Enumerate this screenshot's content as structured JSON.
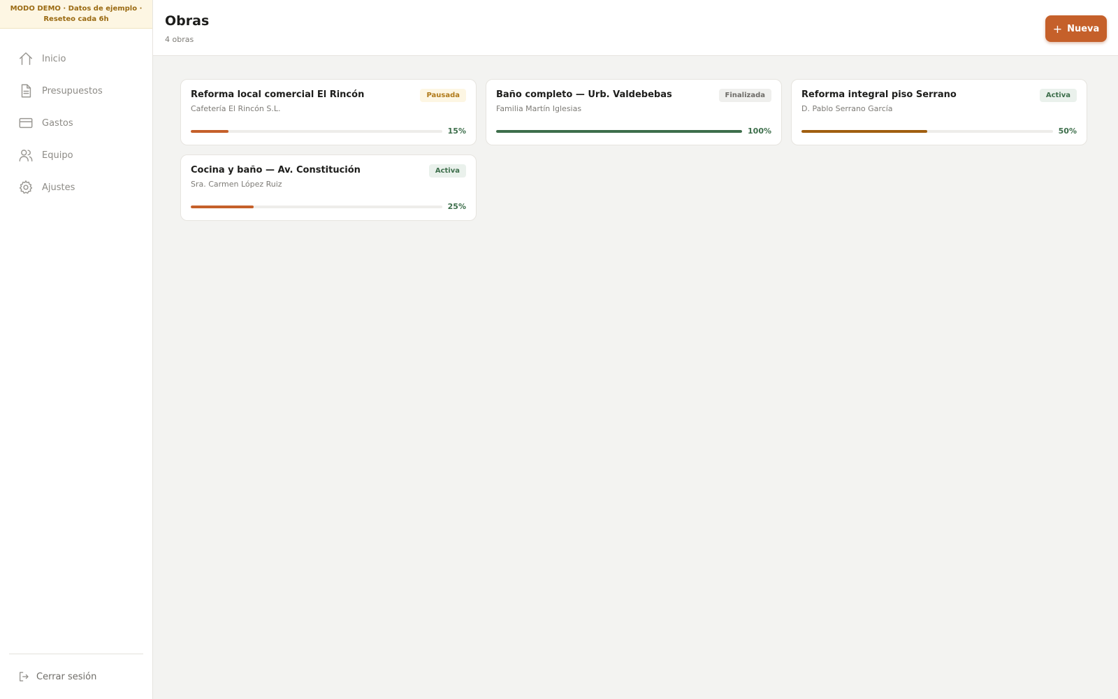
{
  "banner": {
    "line1": "MODO DEMO · Datos de ejemplo ·",
    "line2": "Reseteo cada 6h"
  },
  "sidebar": {
    "items": [
      {
        "label": "Inicio",
        "icon": "home-icon"
      },
      {
        "label": "Presupuestos",
        "icon": "document-icon"
      },
      {
        "label": "Gastos",
        "icon": "credit-card-icon"
      },
      {
        "label": "Equipo",
        "icon": "users-icon"
      },
      {
        "label": "Ajustes",
        "icon": "gear-icon"
      }
    ],
    "logout_label": "Cerrar sesión"
  },
  "header": {
    "title": "Obras",
    "subtitle": "4 obras",
    "new_button_label": "Nueva"
  },
  "colors": {
    "accent": "#c5602a",
    "progress_orange": "#c5602a",
    "progress_green": "#3d6e4b",
    "progress_amber": "#a05f10"
  },
  "projects": [
    {
      "title": "Reforma local comercial El Rincón",
      "client": "Cafetería El Rincón S.L.",
      "status": "Pausada",
      "progress": 15,
      "progress_label": "15%",
      "bar_color": "#c5602a"
    },
    {
      "title": "Baño completo — Urb. Valdebebas",
      "client": "Familia Martín Iglesias",
      "status": "Finalizada",
      "progress": 100,
      "progress_label": "100%",
      "bar_color": "#3d6e4b"
    },
    {
      "title": "Reforma integral piso Serrano",
      "client": "D. Pablo Serrano García",
      "status": "Activa",
      "progress": 50,
      "progress_label": "50%",
      "bar_color": "#a05f10"
    },
    {
      "title": "Cocina y baño — Av. Constitución",
      "client": "Sra. Carmen López Ruiz",
      "status": "Activa",
      "progress": 25,
      "progress_label": "25%",
      "bar_color": "#c5602a"
    }
  ]
}
